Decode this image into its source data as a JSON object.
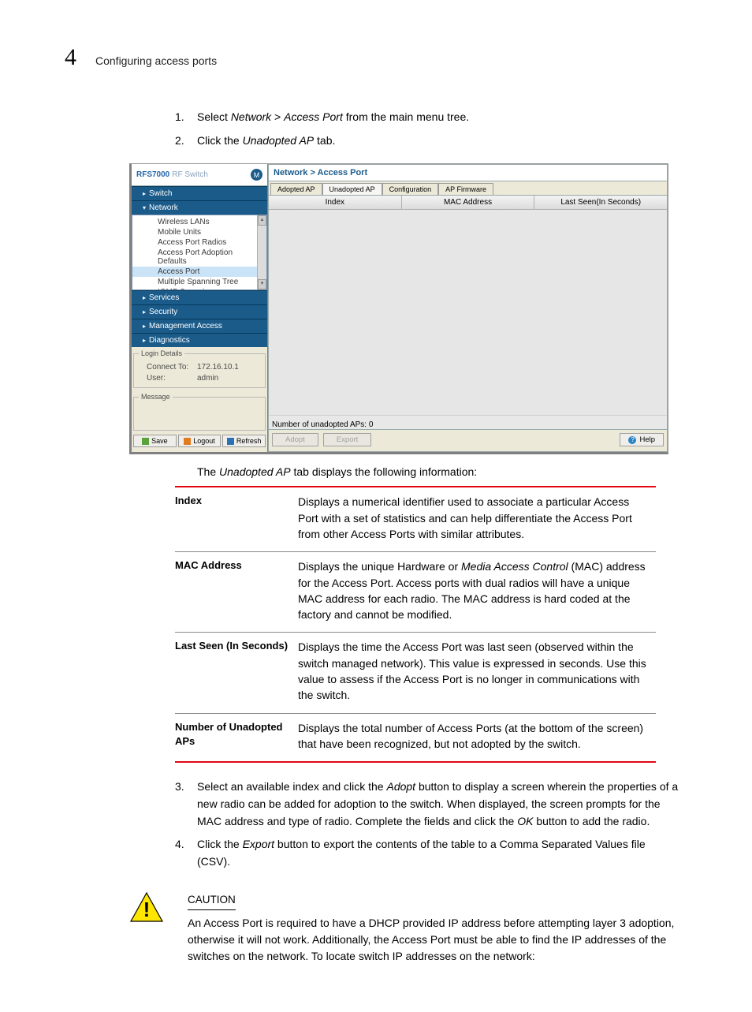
{
  "header": {
    "chapter_number": "4",
    "title": "Configuring access ports"
  },
  "steps_1": [
    {
      "n": "1.",
      "pre": "Select ",
      "i1": "Network",
      "mid": " > ",
      "i2": "Access Port",
      "post": " from the main menu tree."
    },
    {
      "n": "2.",
      "pre": "Click the ",
      "i1": "Unadopted AP",
      "post": " tab."
    }
  ],
  "app": {
    "title_strong": "RFS7000",
    "title_light": "RF Switch",
    "logo_letter": "M",
    "nav": [
      "Switch",
      "Network",
      "Services",
      "Security",
      "Management Access",
      "Diagnostics"
    ],
    "tree": [
      "Wireless LANs",
      "Mobile Units",
      "Access Port Radios",
      "Access Port Adoption Defaults",
      "Access Port",
      "Multiple Spanning Tree",
      "IGMP Snooping"
    ],
    "tree_selected_index": 4,
    "login": {
      "legend": "Login Details",
      "connect_label": "Connect To:",
      "connect_value": "172.16.10.1",
      "user_label": "User:",
      "user_value": "admin"
    },
    "message_legend": "Message",
    "buttons": {
      "save": "Save",
      "logout": "Logout",
      "refresh": "Refresh"
    },
    "breadcrumb": "Network > Access Port",
    "tabs": [
      "Adopted AP",
      "Unadopted AP",
      "Configuration",
      "AP Firmware"
    ],
    "tabs_active_index": 1,
    "grid_headers": [
      "Index",
      "MAC Address",
      "Last Seen(In Seconds)"
    ],
    "status": "Number of unadopted APs:  0",
    "btn_adopt": "Adopt",
    "btn_export": "Export",
    "btn_help": "Help"
  },
  "desc_intro_pre": "The ",
  "desc_intro_i": "Unadopted AP",
  "desc_intro_post": " tab displays the following information:",
  "desc_rows": [
    {
      "k": "Index",
      "v": "Displays a numerical identifier used to associate a particular Access Port with a set of statistics and can help differentiate the Access Port from other Access Ports with similar attributes."
    },
    {
      "k": "MAC Address",
      "v_pre": "Displays the unique Hardware or ",
      "v_i": "Media Access Control",
      "v_post": " (MAC) address for the Access Port. Access ports with dual radios will have a unique MAC address for each radio. The MAC address is hard coded at the factory and cannot be modified."
    },
    {
      "k": "Last Seen (In Seconds)",
      "v": "Displays the time the Access Port was last seen (observed within the switch managed network). This value is expressed in seconds. Use this value to assess if the Access Port is no longer in communications with the switch."
    },
    {
      "k": "Number of Unadopted APs",
      "v": "Displays the total number of Access Ports (at the bottom of the screen) that have been recognized, but not adopted by the switch."
    }
  ],
  "steps_2": [
    {
      "n": "3.",
      "t_pre": "Select an available index and click the ",
      "t_i": "Adopt",
      "t_mid": " button to display a screen wherein the properties of a new radio can be added for adoption to the switch. When displayed, the screen prompts for the MAC address and type of radio. Complete the fields and click the ",
      "t_i2": "OK",
      "t_post": " button to add the radio."
    },
    {
      "n": "4.",
      "t_pre": "Click the ",
      "t_i": "Export",
      "t_post": " button to export the contents of the table to a Comma Separated Values file (CSV)."
    }
  ],
  "caution": {
    "head": "CAUTION",
    "body": "An Access Port is required to have a DHCP provided IP address before attempting layer 3 adoption, otherwise it will not work. Additionally, the Access Port must be able to find the IP addresses of the switches on the network. To locate switch IP addresses on the network:"
  }
}
